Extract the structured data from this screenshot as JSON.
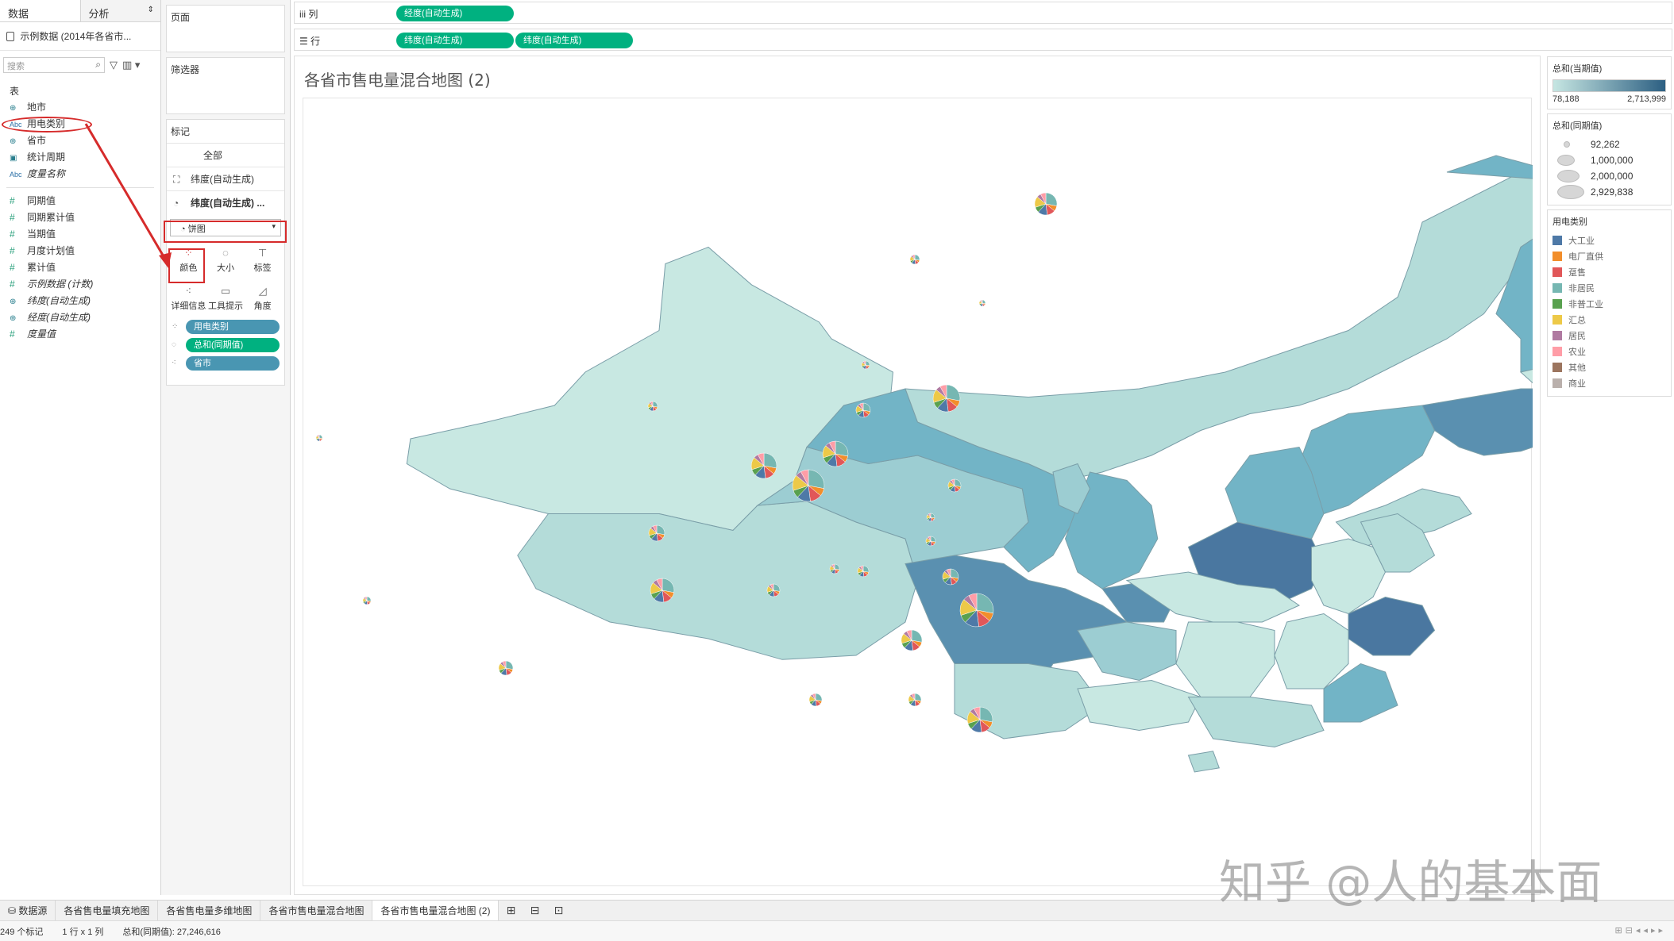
{
  "data_pane": {
    "tabs": [
      "数据",
      "分析"
    ],
    "datasource": "示例数据 (2014年各省市...",
    "search_placeholder": "搜索",
    "section_table": "表",
    "fields_dims": [
      {
        "label": "地市",
        "icon": "globe-icon",
        "type": "geo"
      },
      {
        "label": "用电类别",
        "icon": "abc-icon",
        "type": "abc",
        "circled": true
      },
      {
        "label": "省市",
        "icon": "globe-icon",
        "type": "geo"
      },
      {
        "label": "统计周期",
        "icon": "calendar-icon",
        "type": "date"
      },
      {
        "label": "度量名称",
        "icon": "abc-icon",
        "type": "abc",
        "italic": true
      }
    ],
    "fields_measures": [
      {
        "label": "同期值",
        "italic": false,
        "type": "hash"
      },
      {
        "label": "同期累计值",
        "italic": false,
        "type": "hash"
      },
      {
        "label": "当期值",
        "italic": false,
        "type": "hash"
      },
      {
        "label": "月度计划值",
        "italic": false,
        "type": "hash"
      },
      {
        "label": "累计值",
        "italic": false,
        "type": "hash"
      },
      {
        "label": "示例数据 (计数)",
        "italic": true,
        "type": "hash"
      },
      {
        "label": "纬度(自动生成)",
        "italic": true,
        "type": "geo"
      },
      {
        "label": "经度(自动生成)",
        "italic": true,
        "type": "geo"
      },
      {
        "label": "度量值",
        "italic": true,
        "type": "hash"
      }
    ]
  },
  "shelves": {
    "pages": "页面",
    "filters": "筛选器",
    "marks": "标记",
    "marks_rows": [
      {
        "label": "全部",
        "icon": ""
      },
      {
        "label": "纬度(自动生成)",
        "icon": "map-icon"
      },
      {
        "label": "纬度(自动生成) ...",
        "icon": "pie-icon"
      }
    ],
    "mark_type": "饼图",
    "mark_buttons": [
      {
        "label": "颜色",
        "icon": "color-icon"
      },
      {
        "label": "大小",
        "icon": "size-icon"
      },
      {
        "label": "标签",
        "icon": "label-icon"
      },
      {
        "label": "详细信息",
        "icon": "detail-icon"
      },
      {
        "label": "工具提示",
        "icon": "tooltip-icon"
      },
      {
        "label": "角度",
        "icon": "angle-icon"
      }
    ],
    "mark_pills": [
      {
        "label": "用电类别",
        "color": "blue"
      },
      {
        "label": "总和(同期值)",
        "color": "green"
      },
      {
        "label": "省市",
        "color": "blue"
      }
    ]
  },
  "top_shelves": {
    "columns_label": "列",
    "rows_label": "行",
    "columns_pills": [
      "经度(自动生成)"
    ],
    "rows_pills": [
      "纬度(自动生成)",
      "纬度(自动生成)"
    ]
  },
  "viz": {
    "title": "各省市售电量混合地图 (2)"
  },
  "legends": {
    "color_title": "总和(当期值)",
    "color_min": "78,188",
    "color_max": "2,713,999",
    "size_title": "总和(同期值)",
    "size_values": [
      "92,262",
      "1,000,000",
      "2,000,000",
      "2,929,838"
    ],
    "category_title": "用电类别",
    "categories": [
      {
        "label": "大工业",
        "color": "#4e79a7"
      },
      {
        "label": "电厂直供",
        "color": "#f28e2b"
      },
      {
        "label": "趸售",
        "color": "#e15759"
      },
      {
        "label": "非居民",
        "color": "#76b7b2"
      },
      {
        "label": "非普工业",
        "color": "#59a14f"
      },
      {
        "label": "汇总",
        "color": "#edc948"
      },
      {
        "label": "居民",
        "color": "#b07aa1"
      },
      {
        "label": "农业",
        "color": "#ff9da7"
      },
      {
        "label": "其他",
        "color": "#9c755f"
      },
      {
        "label": "商业",
        "color": "#bab0ac"
      }
    ]
  },
  "sheet_tabs": {
    "datasource": "数据源",
    "sheets": [
      "各省售电量填充地图",
      "各省售电量多维地图",
      "各省市售电量混合地图",
      "各省市售电量混合地图 (2)"
    ],
    "active_index": 3
  },
  "status": {
    "marks": "249 个标记",
    "rows_cols": "1 行 x 1 列",
    "sum": "总和(同期值): 27,246,616"
  },
  "watermark": "知乎 @人的基本面",
  "map_colors": {
    "lightest": "#c8e8e2",
    "light": "#b4dcd9",
    "mid": "#9ccdd2",
    "midblue": "#72b4c6",
    "dark": "#5a90b0",
    "darkest": "#4a77a0"
  }
}
